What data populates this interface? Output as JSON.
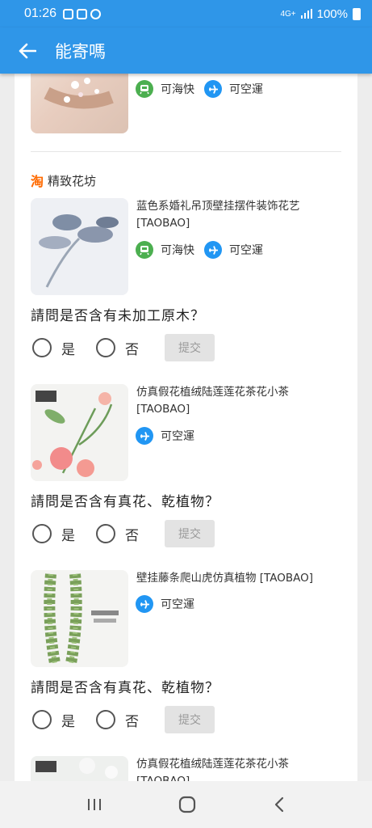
{
  "status_bar": {
    "time": "01:26",
    "battery": "100%",
    "network": "4G+"
  },
  "app_bar": {
    "title": "能寄嗎"
  },
  "store_name": "精致花坊",
  "store_badge": "淘",
  "shipping": {
    "sea_express": "可海快",
    "air": "可空運"
  },
  "products": [
    {
      "name": "",
      "shipping": [
        "sea_express",
        "air"
      ]
    },
    {
      "name": "蓝色系婚礼吊顶壁挂摆件装饰花艺 [TAOBAO]",
      "shipping": [
        "sea_express",
        "air"
      ],
      "question": "請問是否含有未加工原木？"
    },
    {
      "name": "仿真假花植绒陆莲莲花茶花小茶 [TAOBAO]",
      "shipping": [
        "air"
      ],
      "question": "請問是否含有真花、乾植物？"
    },
    {
      "name": "壁挂藤条爬山虎仿真植物 [TAOBAO]",
      "shipping": [
        "air"
      ],
      "question": "請問是否含有真花、乾植物？"
    },
    {
      "name": "仿真假花植绒陆莲莲花茶花小茶 [TAOBAO]"
    }
  ],
  "answers": {
    "yes": "是",
    "no": "否",
    "submit": "提交"
  },
  "colors": {
    "primary": "#2f96e8",
    "sea_icon": "#4caf50",
    "air_icon": "#2196f3",
    "taobao": "#ff6a00"
  }
}
